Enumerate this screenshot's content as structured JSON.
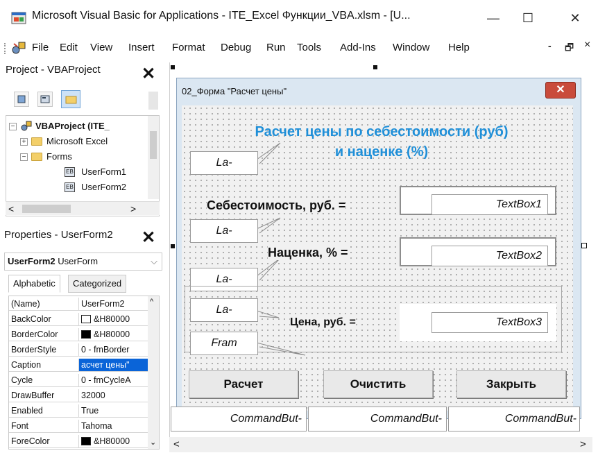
{
  "window": {
    "title": "Microsoft Visual Basic for Applications - ITE_Excel Функции_VBA.xlsm - [U...",
    "minimize": "—",
    "maximize": "☐",
    "close": "✕"
  },
  "menu": {
    "items": [
      "File",
      "Edit",
      "View",
      "Insert",
      "Format",
      "Debug",
      "Run",
      "Tools",
      "Add-Ins",
      "Window",
      "Help"
    ],
    "mdi_minimize": "-",
    "mdi_restore": "🗗",
    "mdi_close": "×"
  },
  "project_pane": {
    "title": "Project - VBAProject",
    "close": "✕",
    "tree": {
      "root": "VBAProject (ITE_",
      "excel_objects": "Microsoft Excel",
      "forms": "Forms",
      "form1": "UserForm1",
      "form2": "UserForm2"
    }
  },
  "properties_pane": {
    "title": "Properties - UserForm2",
    "close": "✕",
    "object_name": "UserForm2",
    "object_type": "UserForm",
    "tabs": [
      "Alphabetic",
      "Categorized"
    ],
    "rows": [
      {
        "name": "(Name)",
        "value": "UserForm2"
      },
      {
        "name": "BackColor",
        "value": "&H80000"
      },
      {
        "name": "BorderColor",
        "value": "&H80000"
      },
      {
        "name": "BorderStyle",
        "value": "0 - fmBorder"
      },
      {
        "name": "Caption",
        "value": "асчет цены\""
      },
      {
        "name": "Cycle",
        "value": "0 - fmCycleA"
      },
      {
        "name": "DrawBuffer",
        "value": "32000"
      },
      {
        "name": "Enabled",
        "value": "True"
      },
      {
        "name": "Font",
        "value": "Tahoma"
      },
      {
        "name": "ForeColor",
        "value": "&H80000"
      }
    ],
    "colors": {
      "backcolor_swatch": "#ffffff",
      "bordercolor_swatch": "#000000",
      "forecolor_swatch": "#000000",
      "selected_row": "#0a64d8"
    }
  },
  "form": {
    "caption": "02_Форма \"Расчет цены\"",
    "close": "✕",
    "heading_line1": "Расчет цены по себестоимости (руб)",
    "heading_line2": "и наценке (%)",
    "heading_color": "#1f8fd8",
    "label_cost": "Себестоимость, руб. =",
    "label_markup": "Наценка, % =",
    "label_price": "Цена, руб. =",
    "textbox1": "TextBox1",
    "textbox2": "TextBox2",
    "textbox3": "TextBox3",
    "btn_calc": "Расчет",
    "btn_clear": "Очистить",
    "btn_close": "Закрыть"
  },
  "callouts": {
    "label1": "La-",
    "label2": "La-",
    "label3": "La-",
    "label4": "La-",
    "frame": "Fram",
    "cmd1": "CommandBut-",
    "cmd2": "CommandBut-",
    "cmd3": "CommandBut-"
  }
}
